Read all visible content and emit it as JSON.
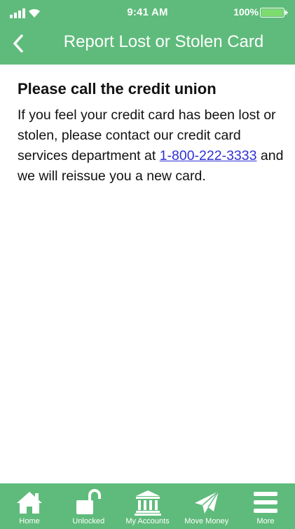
{
  "status_bar": {
    "time": "9:41 AM",
    "battery_percent": "100%",
    "signal_icon": "signal-bars-icon",
    "wifi_icon": "wifi-icon",
    "battery_icon": "battery-icon"
  },
  "nav": {
    "title": "Report Lost or Stolen Card",
    "back_icon": "chevron-left-icon"
  },
  "content": {
    "heading": "Please call the credit union",
    "body_before_link": "If you feel your credit card has been lost or stolen, please contact our credit card services department at ",
    "phone_link": "1-800-222-3333",
    "body_after_link": " and we will reissue you a new card."
  },
  "tab_bar": {
    "tabs": [
      {
        "label": "Home",
        "icon": "home-icon"
      },
      {
        "label": "Unlocked",
        "icon": "unlocked-padlock-icon"
      },
      {
        "label": "My Accounts",
        "icon": "bank-icon"
      },
      {
        "label": "Move Money",
        "icon": "paper-plane-icon"
      },
      {
        "label": "More",
        "icon": "hamburger-menu-icon"
      }
    ]
  },
  "colors": {
    "brand_green": "#5fbb7b",
    "link_blue": "#2f2fd4",
    "battery_fill": "#7ddc6e"
  }
}
